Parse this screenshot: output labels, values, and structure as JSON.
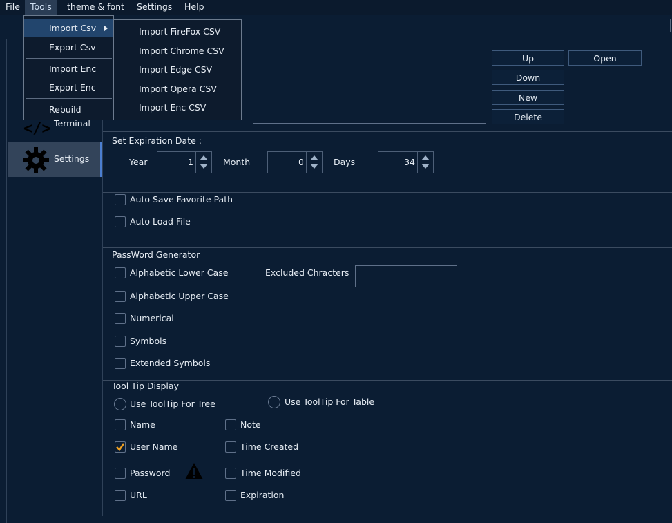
{
  "menubar": {
    "file": "File",
    "tools": "Tools",
    "theme": "theme & font",
    "settings": "Settings",
    "help": "Help"
  },
  "tools_menu": {
    "import_csv": "Import Csv",
    "export_csv": "Export Csv",
    "import_enc": "Import Enc",
    "export_enc": "Export Enc",
    "rebuild": "Rebuild"
  },
  "import_submenu": [
    "Import FireFox CSV",
    "Import Chrome CSV",
    "Import Edge CSV",
    "Import Opera CSV",
    "Import Enc CSV"
  ],
  "sidebar": {
    "terminal": "Terminal",
    "settings": "Settings"
  },
  "list_buttons": {
    "up": "Up",
    "open": "Open",
    "down": "Down",
    "new": "New",
    "delete": "Delete"
  },
  "expiration": {
    "title": "Set Expiration Date :",
    "year_label": "Year",
    "year": "1",
    "month_label": "Month",
    "month": "0",
    "days_label": "Days",
    "days": "34"
  },
  "auto": {
    "save_path": "Auto Save Favorite Path",
    "load_file": "Auto Load File"
  },
  "password_generator": {
    "title": "PassWord Generator",
    "lower": "Alphabetic Lower Case",
    "upper": "Alphabetic Upper Case",
    "numerical": "Numerical",
    "symbols": "Symbols",
    "extended": "Extended Symbols",
    "excluded_label": "Excluded Chracters",
    "excluded_value": ""
  },
  "tooltip": {
    "title": "Tool Tip Display",
    "tree": "Use ToolTip For Tree",
    "table": "Use ToolTip For Table",
    "name": "Name",
    "note": "Note",
    "user_name": "User Name",
    "user_name_checked": true,
    "time_created": "Time Created",
    "password": "Password",
    "time_modified": "Time Modified",
    "url": "URL",
    "expiration": "Expiration"
  },
  "colors": {
    "background": "#0b1d33",
    "accent": "#4c7fd1",
    "check": "#f0a020"
  }
}
